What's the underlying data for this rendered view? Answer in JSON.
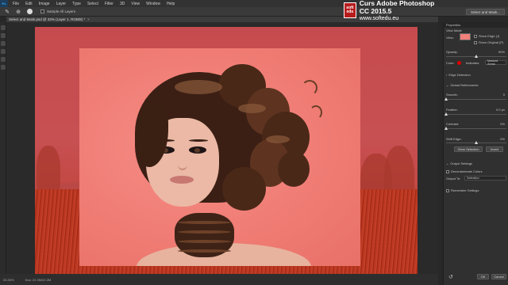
{
  "menubar": {
    "logo": "Ps",
    "items": [
      "File",
      "Edit",
      "Image",
      "Layer",
      "Type",
      "Select",
      "Filter",
      "3D",
      "View",
      "Window",
      "Help"
    ]
  },
  "options_bar": {
    "sample_all_layers": "Sample All Layers",
    "select_and_mask": "Select and Mask..."
  },
  "document": {
    "tab_title": "Select and Mask.psd @ 33% (Layer 1, RGB/8) *",
    "zoom": "33.33%",
    "doc_info": "Doc: 22.2M/22.2M"
  },
  "watermark": {
    "logo_lines": [
      "soft",
      "edu"
    ],
    "course_title": "Curs Adobe Photoshop CC 2015.5",
    "website": "www.softedu.eu"
  },
  "properties": {
    "title": "Properties",
    "view_mode_header": "View Mode",
    "view_label": "View:",
    "show_edge": "Show Edge (J)",
    "show_original": "Show Original (P)",
    "opacity_label": "Opacity:",
    "opacity_value": "50%",
    "opacity_fraction": 0.5,
    "color_label": "Color:",
    "indicates_label": "Indicates:",
    "indicates_value": "Masked Areas",
    "edge_detection_header": "Edge Detection",
    "global_refinements_header": "Global Refinements",
    "smooth_label": "Smooth:",
    "smooth_value": "0",
    "feather_label": "Feather:",
    "feather_value": "0.0 px",
    "contrast_label": "Contrast:",
    "contrast_value": "0%",
    "shift_edge_label": "Shift Edge:",
    "shift_edge_value": "0%",
    "clear_selection": "Clear Selection",
    "invert": "Invert",
    "output_settings_header": "Output Settings",
    "decontaminate": "Decontaminate Colors",
    "output_to_label": "Output To:",
    "output_to_value": "Selection",
    "remember": "Remember Settings",
    "ok": "OK",
    "cancel": "Cancel",
    "accent_color": "#e00000"
  }
}
